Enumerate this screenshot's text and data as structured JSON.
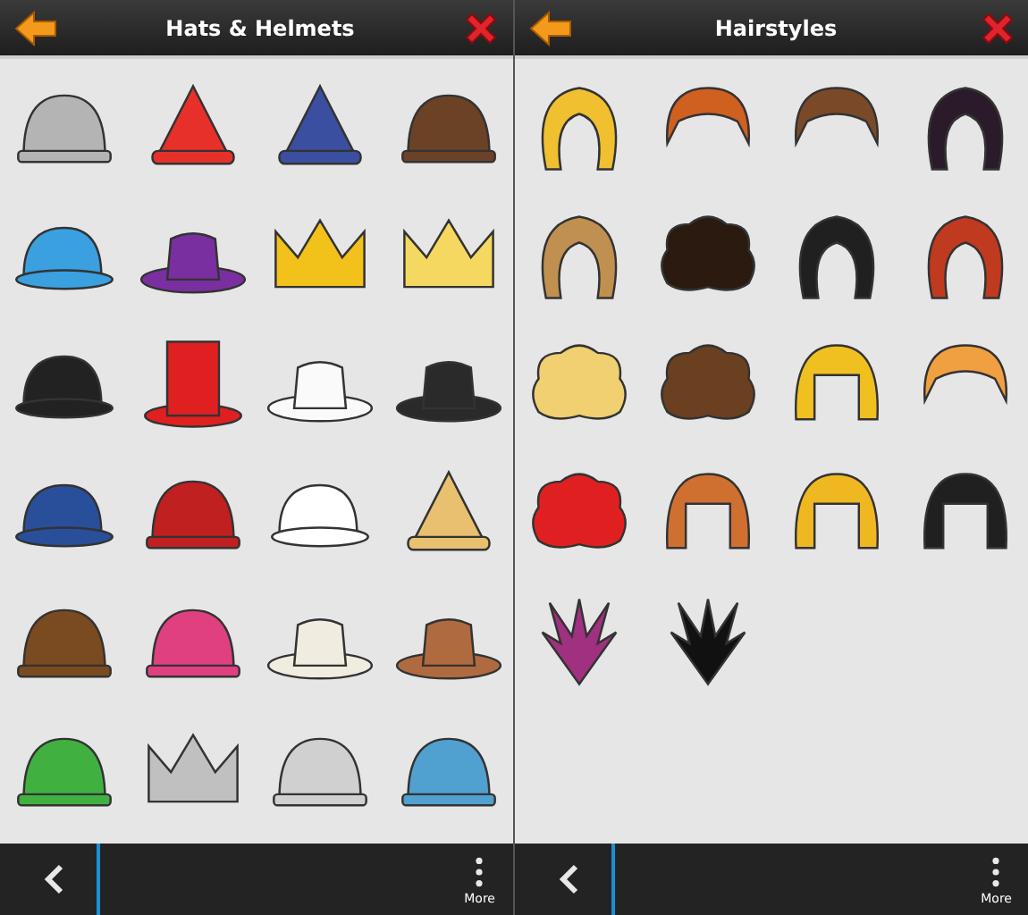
{
  "panels": [
    {
      "title": "Hats & Helmets",
      "items": [
        {
          "kind": "helmet",
          "color": "#b4b4b4"
        },
        {
          "kind": "pointed",
          "color": "#e8302a"
        },
        {
          "kind": "pointed",
          "color": "#3b4fa0"
        },
        {
          "kind": "helmet",
          "color": "#6b4226"
        },
        {
          "kind": "cap",
          "color": "#3aa0e0"
        },
        {
          "kind": "brim",
          "color": "#7a2fa0"
        },
        {
          "kind": "crown",
          "color": "#f2c21a"
        },
        {
          "kind": "crown",
          "color": "#f5d860"
        },
        {
          "kind": "cap",
          "color": "#222222"
        },
        {
          "kind": "tall",
          "color": "#e02020"
        },
        {
          "kind": "brim",
          "color": "#fafafa"
        },
        {
          "kind": "brim",
          "color": "#2a2a2a"
        },
        {
          "kind": "cap",
          "color": "#2a4f9a"
        },
        {
          "kind": "helmet",
          "color": "#c02020"
        },
        {
          "kind": "cap",
          "color": "#ffffff"
        },
        {
          "kind": "pointed",
          "color": "#e8c070"
        },
        {
          "kind": "helmet",
          "color": "#7a4a20"
        },
        {
          "kind": "helmet",
          "color": "#e04080"
        },
        {
          "kind": "brim",
          "color": "#f0ece0"
        },
        {
          "kind": "brim",
          "color": "#b06a40"
        },
        {
          "kind": "helmet",
          "color": "#40b040"
        },
        {
          "kind": "crown",
          "color": "#c0c0c0"
        },
        {
          "kind": "helmet",
          "color": "#d0d0d0"
        },
        {
          "kind": "helmet",
          "color": "#50a0d0"
        }
      ],
      "more_label": "More"
    },
    {
      "title": "Hairstyles",
      "items": [
        {
          "kind": "long",
          "color": "#f0c030"
        },
        {
          "kind": "short",
          "color": "#d06020"
        },
        {
          "kind": "short",
          "color": "#7a4a28"
        },
        {
          "kind": "long",
          "color": "#2a1a2a"
        },
        {
          "kind": "long",
          "color": "#c09050"
        },
        {
          "kind": "curly",
          "color": "#2a1a10"
        },
        {
          "kind": "long",
          "color": "#202020"
        },
        {
          "kind": "long",
          "color": "#c03a20"
        },
        {
          "kind": "curly",
          "color": "#f0d070"
        },
        {
          "kind": "curly",
          "color": "#6a4020"
        },
        {
          "kind": "bob",
          "color": "#f0c020"
        },
        {
          "kind": "short",
          "color": "#f0a040"
        },
        {
          "kind": "curly",
          "color": "#e02020"
        },
        {
          "kind": "bob",
          "color": "#d07030"
        },
        {
          "kind": "bob",
          "color": "#f0b820"
        },
        {
          "kind": "bob",
          "color": "#202020"
        },
        {
          "kind": "spiky",
          "color": "#a03080"
        },
        {
          "kind": "spiky",
          "color": "#111111"
        }
      ],
      "more_label": "More"
    }
  ]
}
